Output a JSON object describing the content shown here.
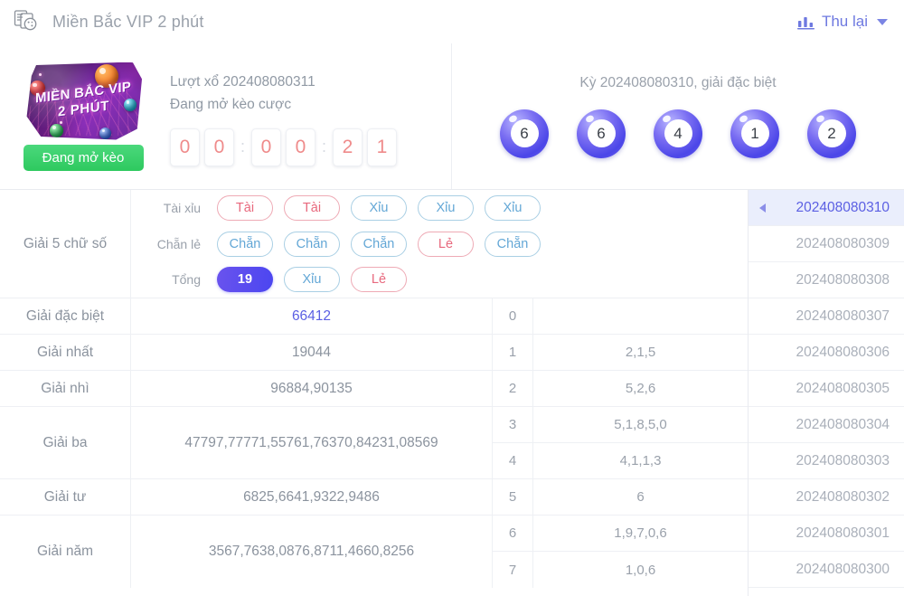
{
  "header": {
    "icon": "lottery-ticket-icon",
    "title": "Miền Bắc VIP 2 phút",
    "action_icon": "bar-chart-icon",
    "action_label": "Thu lại",
    "chevron": "chevron-down-icon"
  },
  "brand": {
    "line1": "MIỀN BẮC VIP",
    "line2": "2 PHÚT",
    "badge": "Đang mở kèo",
    "badge_color": "#2ec95f"
  },
  "draw": {
    "round_label": "Lượt xổ 202408080311",
    "status": "Đang mở kèo cược",
    "countdown": [
      "0",
      "0",
      "0",
      "0",
      "2",
      "1"
    ],
    "separator": ":",
    "digit_color": "#ef8b8b"
  },
  "result": {
    "title": "Kỳ 202408080310, giải đặc biệt",
    "balls": [
      "6",
      "6",
      "4",
      "1",
      "2"
    ],
    "ball_color": "#4b46e8"
  },
  "bets": {
    "group_label": "Giải 5 chữ số",
    "rows": [
      {
        "name": "Tài xỉu",
        "tags": [
          {
            "label": "Tài",
            "style": "red"
          },
          {
            "label": "Tài",
            "style": "red"
          },
          {
            "label": "Xỉu",
            "style": "blue"
          },
          {
            "label": "Xỉu",
            "style": "blue"
          },
          {
            "label": "Xỉu",
            "style": "blue"
          }
        ]
      },
      {
        "name": "Chẵn lẻ",
        "tags": [
          {
            "label": "Chẵn",
            "style": "blue"
          },
          {
            "label": "Chẵn",
            "style": "blue"
          },
          {
            "label": "Chẵn",
            "style": "blue"
          },
          {
            "label": "Lẻ",
            "style": "red"
          },
          {
            "label": "Chẵn",
            "style": "blue"
          }
        ]
      },
      {
        "name": "Tổng",
        "tags": [
          {
            "label": "19",
            "style": "fill"
          },
          {
            "label": "Xỉu",
            "style": "blue"
          },
          {
            "label": "Lẻ",
            "style": "red"
          }
        ]
      }
    ]
  },
  "prizes": [
    {
      "label": "Giải đặc biệt",
      "value": "66412",
      "special": true,
      "span": 1
    },
    {
      "label": "Giải nhất",
      "value": "19044",
      "special": false,
      "span": 1
    },
    {
      "label": "Giải nhì",
      "value": "96884,90135",
      "special": false,
      "span": 1
    },
    {
      "label": "Giải ba",
      "value": "47797,77771,55761,76370,84231,08569",
      "special": false,
      "span": 2
    },
    {
      "label": "Giải tư",
      "value": "6825,6641,9322,9486",
      "special": false,
      "span": 1
    },
    {
      "label": "Giải năm",
      "value": "3567,7638,0876,8711,4660,8256",
      "special": false,
      "span": 2
    }
  ],
  "digit_table": [
    {
      "index": "0",
      "values": ""
    },
    {
      "index": "1",
      "values": "2,1,5"
    },
    {
      "index": "2",
      "values": "5,2,6"
    },
    {
      "index": "3",
      "values": "5,1,8,5,0"
    },
    {
      "index": "4",
      "values": "4,1,1,3"
    },
    {
      "index": "5",
      "values": "6"
    },
    {
      "index": "6",
      "values": "1,9,7,0,6"
    },
    {
      "index": "7",
      "values": "1,0,6"
    }
  ],
  "periods": [
    {
      "id": "202408080310",
      "active": true
    },
    {
      "id": "202408080309",
      "active": false
    },
    {
      "id": "202408080308",
      "active": false
    },
    {
      "id": "202408080307",
      "active": false
    },
    {
      "id": "202408080306",
      "active": false
    },
    {
      "id": "202408080305",
      "active": false
    },
    {
      "id": "202408080304",
      "active": false
    },
    {
      "id": "202408080303",
      "active": false
    },
    {
      "id": "202408080302",
      "active": false
    },
    {
      "id": "202408080301",
      "active": false
    },
    {
      "id": "202408080300",
      "active": false
    }
  ]
}
